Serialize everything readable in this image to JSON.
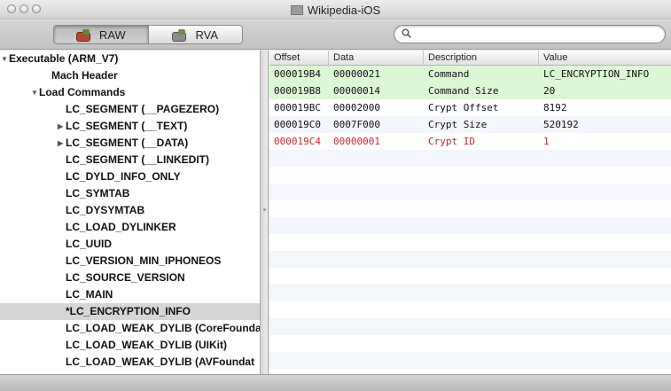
{
  "window": {
    "title": "Wikipedia-iOS"
  },
  "toolbar": {
    "segments": [
      {
        "label": "RAW",
        "active": true
      },
      {
        "label": "RVA",
        "active": false
      }
    ],
    "search": {
      "value": "",
      "placeholder": ""
    }
  },
  "tree": {
    "items": [
      {
        "label": "Executable  (ARM_V7)",
        "expanded": true
      },
      {
        "label": "Mach Header"
      },
      {
        "label": "Load Commands",
        "expanded": true
      },
      {
        "label": "LC_SEGMENT (__PAGEZERO)"
      },
      {
        "label": "LC_SEGMENT (__TEXT)",
        "collapsed": true
      },
      {
        "label": "LC_SEGMENT (__DATA)",
        "collapsed": true
      },
      {
        "label": "LC_SEGMENT (__LINKEDIT)"
      },
      {
        "label": "LC_DYLD_INFO_ONLY"
      },
      {
        "label": "LC_SYMTAB"
      },
      {
        "label": "LC_DYSYMTAB"
      },
      {
        "label": "LC_LOAD_DYLINKER"
      },
      {
        "label": "LC_UUID"
      },
      {
        "label": "LC_VERSION_MIN_IPHONEOS"
      },
      {
        "label": "LC_SOURCE_VERSION"
      },
      {
        "label": "LC_MAIN"
      },
      {
        "label": "*LC_ENCRYPTION_INFO",
        "selected": true
      },
      {
        "label": "LC_LOAD_WEAK_DYLIB (CoreFounda"
      },
      {
        "label": "LC_LOAD_WEAK_DYLIB (UIKit)"
      },
      {
        "label": "LC_LOAD_WEAK_DYLIB (AVFoundat"
      }
    ]
  },
  "table": {
    "columns": [
      "Offset",
      "Data",
      "Description",
      "Value"
    ],
    "rows": [
      {
        "offset": "000019B4",
        "data": "00000021",
        "description": "Command",
        "value": "LC_ENCRYPTION_INFO",
        "style": "green"
      },
      {
        "offset": "000019B8",
        "data": "00000014",
        "description": "Command Size",
        "value": "20",
        "style": "green"
      },
      {
        "offset": "000019BC",
        "data": "00002000",
        "description": "Crypt Offset",
        "value": "8192",
        "style": "plain"
      },
      {
        "offset": "000019C0",
        "data": "0007F000",
        "description": "Crypt Size",
        "value": "520192",
        "style": "plain"
      },
      {
        "offset": "000019C4",
        "data": "00000001",
        "description": "Crypt ID",
        "value": "1",
        "style": "red"
      }
    ],
    "empty_rows": 13
  },
  "colors": {
    "green_row": "#dcf7d6",
    "red_text": "#d22727",
    "selected_row": "#d6d6d6",
    "alt_row": "#f3f6fa"
  },
  "icons": [
    "window-close-icon",
    "window-minimize-icon",
    "window-zoom-icon",
    "app-document-icon",
    "raw-icon",
    "rva-icon",
    "search-icon",
    "disclosure-triangle-icon"
  ]
}
